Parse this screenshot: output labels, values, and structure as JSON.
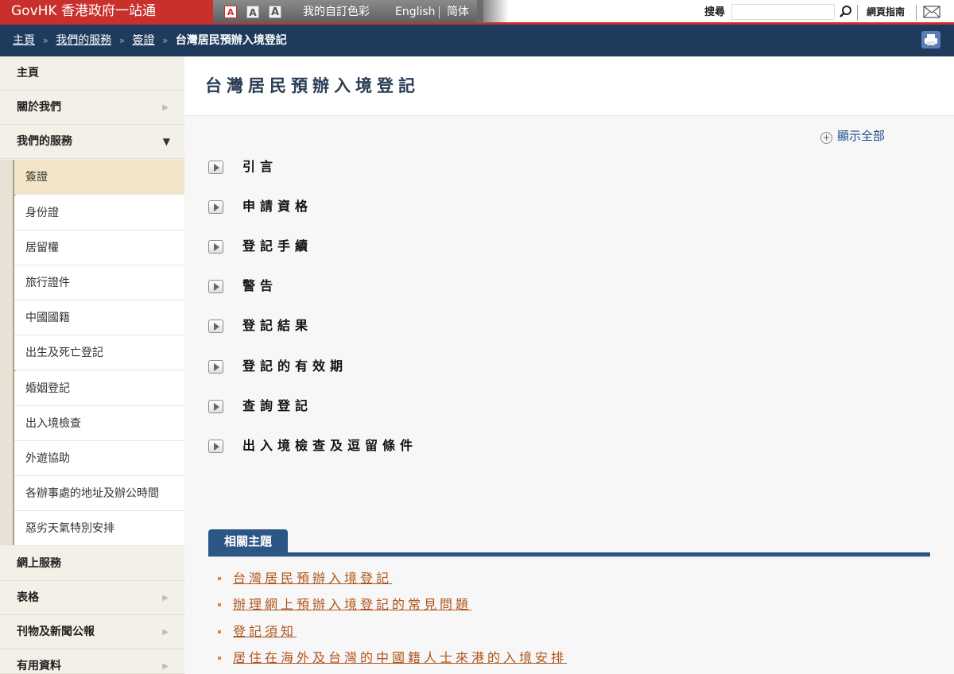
{
  "topbar": {
    "brand": "GovHK 香港政府一站通",
    "font_size_buttons": [
      "A",
      "A",
      "A"
    ],
    "custom_colour": "我的自訂色彩",
    "english": "English",
    "simplified": "简体",
    "search_label": "搜尋",
    "search_value": "",
    "site_guide": "網頁指南",
    "icons": [
      "search-icon",
      "mail-icon"
    ]
  },
  "breadcrumb": {
    "items": [
      "主頁",
      "我們的服務",
      "簽證"
    ],
    "separator": "»",
    "current": "台灣居民預辦入境登記",
    "icons": [
      "print-icon"
    ]
  },
  "sidebar": {
    "main_top": [
      "主頁",
      "關於我們",
      "我們的服務"
    ],
    "sub_items": [
      "簽證",
      "身份證",
      "居留權",
      "旅行證件",
      "中國國籍",
      "出生及死亡登記",
      "婚姻登記",
      "出入境檢查",
      "外遊協助",
      "各辦事處的地址及辦公時間",
      "惡劣天氣特別安排"
    ],
    "active_sub": "簽證",
    "main_bottom": [
      "網上服務",
      "表格",
      "刊物及新聞公報",
      "有用資料"
    ]
  },
  "main": {
    "title": "台灣居民預辦入境登記",
    "show_all": "顯示全部",
    "sections": [
      "引言",
      "申請資格",
      "登記手續",
      "警告",
      "登記結果",
      "登記的有效期",
      "查詢登記",
      "出入境檢查及逗留條件"
    ],
    "related": {
      "tab": "相關主題",
      "links": [
        "台灣居民預辦入境登記",
        "辦理網上預辦入境登記的常見問題",
        "登記須知",
        "居住在海外及台灣的中國籍人士來港的入境安排"
      ]
    }
  },
  "colors": {
    "brand_red": "#c9302c",
    "nav_blue": "#1e3a5c",
    "sidebar_bg": "#f3f0e8",
    "active_bg": "#f3e6c8",
    "link_orange": "#b0551b",
    "tab_blue": "#2b5686"
  }
}
